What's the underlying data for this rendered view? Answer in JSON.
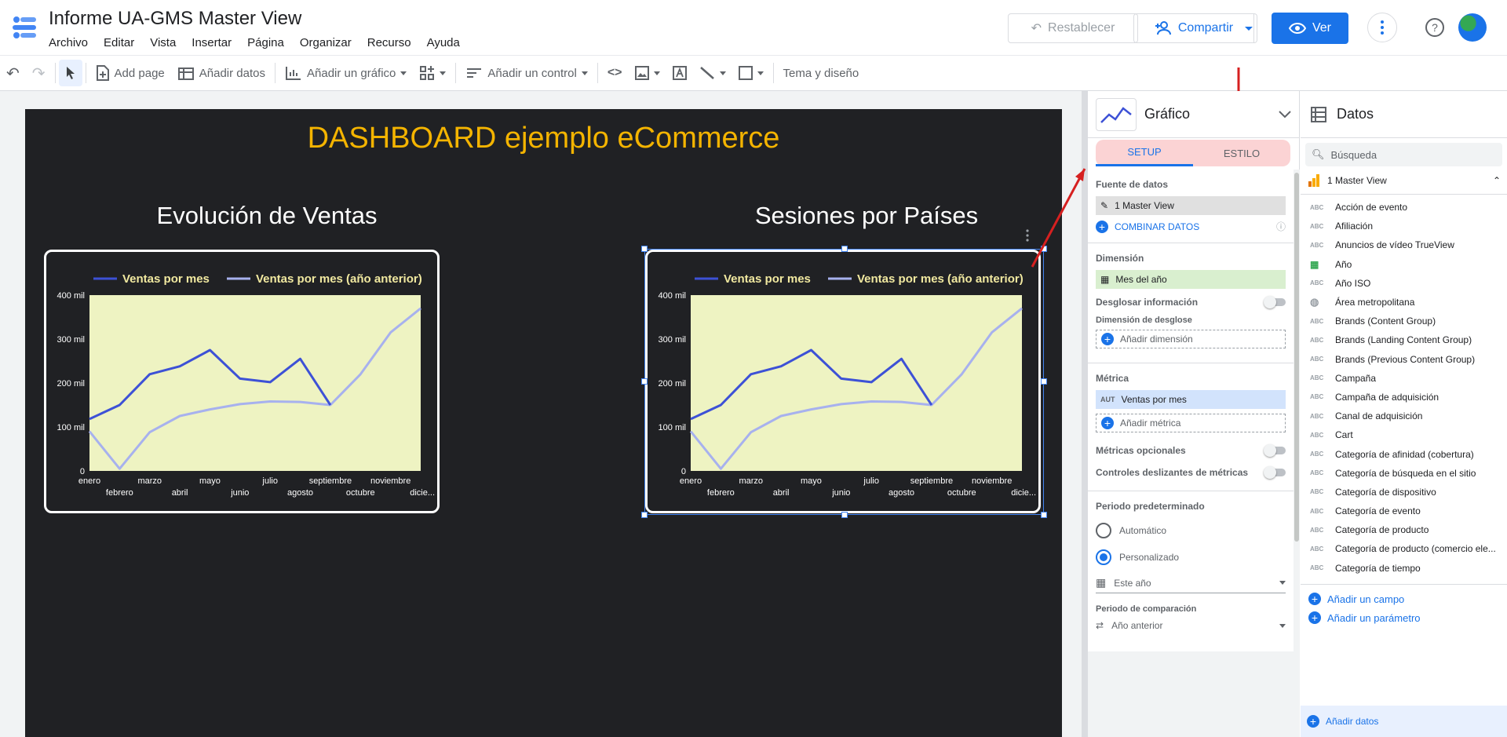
{
  "app": {
    "title": "Informe UA-GMS Master View",
    "menu": [
      "Archivo",
      "Editar",
      "Vista",
      "Insertar",
      "Página",
      "Organizar",
      "Recurso",
      "Ayuda"
    ],
    "buttons": {
      "reset": "Restablecer",
      "share": "Compartir",
      "view": "Ver"
    }
  },
  "toolbar": {
    "add_page": "Add page",
    "add_data": "Añadir datos",
    "add_chart": "Añadir un gráfico",
    "add_control": "Añadir un control",
    "theme": "Tema y diseño"
  },
  "dashboard": {
    "title": "DASHBOARD ejemplo eCommerce",
    "charts": [
      {
        "title": "Evolución de Ventas"
      },
      {
        "title": "Sesiones por Países"
      }
    ]
  },
  "chart_data": [
    {
      "type": "line",
      "title": "Evolución de Ventas",
      "categories": [
        "enero",
        "febrero",
        "marzo",
        "abril",
        "mayo",
        "junio",
        "julio",
        "agosto",
        "septiembre",
        "octubre",
        "noviembre",
        "dicie..."
      ],
      "series": [
        {
          "name": "Ventas por mes",
          "values": [
            118000,
            150000,
            220000,
            238000,
            275000,
            210000,
            202000,
            255000,
            150000,
            null,
            null,
            null
          ]
        },
        {
          "name": "Ventas por mes (año anterior)",
          "values": [
            90000,
            5000,
            88000,
            125000,
            140000,
            152000,
            158000,
            157000,
            150000,
            220000,
            315000,
            370000
          ]
        }
      ],
      "yticks": [
        "0",
        "100 mil",
        "200 mil",
        "300 mil",
        "400 mil"
      ],
      "ylim": [
        0,
        400000
      ],
      "legend": "top",
      "colors": {
        "series1": "#3d51d6",
        "series2": "#a7b1ee",
        "plot_bg": "#eef3c2"
      }
    },
    {
      "type": "line",
      "title": "Sesiones por Países",
      "categories": [
        "enero",
        "febrero",
        "marzo",
        "abril",
        "mayo",
        "junio",
        "julio",
        "agosto",
        "septiembre",
        "octubre",
        "noviembre",
        "dicie..."
      ],
      "series": [
        {
          "name": "Ventas por mes",
          "values": [
            118000,
            150000,
            220000,
            238000,
            275000,
            210000,
            202000,
            255000,
            150000,
            null,
            null,
            null
          ]
        },
        {
          "name": "Ventas por mes (año anterior)",
          "values": [
            90000,
            5000,
            88000,
            125000,
            140000,
            152000,
            158000,
            157000,
            150000,
            220000,
            315000,
            370000
          ]
        }
      ],
      "yticks": [
        "0",
        "100 mil",
        "200 mil",
        "300 mil",
        "400 mil"
      ],
      "ylim": [
        0,
        400000
      ],
      "legend": "top",
      "colors": {
        "series1": "#3d51d6",
        "series2": "#a7b1ee",
        "plot_bg": "#eef3c2"
      }
    }
  ],
  "props": {
    "header": "Gráfico",
    "tabs": {
      "setup": "SETUP",
      "style": "ESTILO"
    },
    "data_source_label": "Fuente de datos",
    "data_source": "1 Master View",
    "combine": "COMBINAR DATOS",
    "dimension_label": "Dimensión",
    "dimension": "Mes del año",
    "drilldown_label": "Desglosar información",
    "breakdown_label": "Dimensión de desglose",
    "add_dimension": "Añadir dimensión",
    "metric_label": "Métrica",
    "metric_type": "AUT",
    "metric": "Ventas por mes",
    "add_metric": "Añadir métrica",
    "optional_metrics": "Métricas opcionales",
    "metric_sliders": "Controles deslizantes de métricas",
    "default_period_label": "Periodo predeterminado",
    "auto": "Automático",
    "custom": "Personalizado",
    "this_year": "Este año",
    "comparison_label": "Periodo de comparación",
    "prev_year": "Año anterior"
  },
  "data_panel": {
    "header": "Datos",
    "search_placeholder": "Búsqueda",
    "source": "1 Master View",
    "fields": [
      {
        "type": "ABC",
        "name": "Acción de evento"
      },
      {
        "type": "ABC",
        "name": "Afiliación"
      },
      {
        "type": "ABC",
        "name": "Anuncios de vídeo TrueView"
      },
      {
        "type": "date",
        "name": "Año"
      },
      {
        "type": "ABC",
        "name": "Año ISO"
      },
      {
        "type": "geo",
        "name": "Área metropolitana"
      },
      {
        "type": "ABC",
        "name": "Brands (Content Group)"
      },
      {
        "type": "ABC",
        "name": "Brands (Landing Content Group)"
      },
      {
        "type": "ABC",
        "name": "Brands (Previous Content Group)"
      },
      {
        "type": "ABC",
        "name": "Campaña"
      },
      {
        "type": "ABC",
        "name": "Campaña de adquisición"
      },
      {
        "type": "ABC",
        "name": "Canal de adquisición"
      },
      {
        "type": "ABC",
        "name": "Cart"
      },
      {
        "type": "ABC",
        "name": "Categoría de afinidad (cobertura)"
      },
      {
        "type": "ABC",
        "name": "Categoría de búsqueda en el sitio"
      },
      {
        "type": "ABC",
        "name": "Categoría de dispositivo"
      },
      {
        "type": "ABC",
        "name": "Categoría de evento"
      },
      {
        "type": "ABC",
        "name": "Categoría de producto"
      },
      {
        "type": "ABC",
        "name": "Categoría de producto (comercio ele..."
      },
      {
        "type": "ABC",
        "name": "Categoría de tiempo"
      }
    ],
    "add_field": "Añadir un campo",
    "add_param": "Añadir un parámetro",
    "add_data": "Añadir datos"
  }
}
